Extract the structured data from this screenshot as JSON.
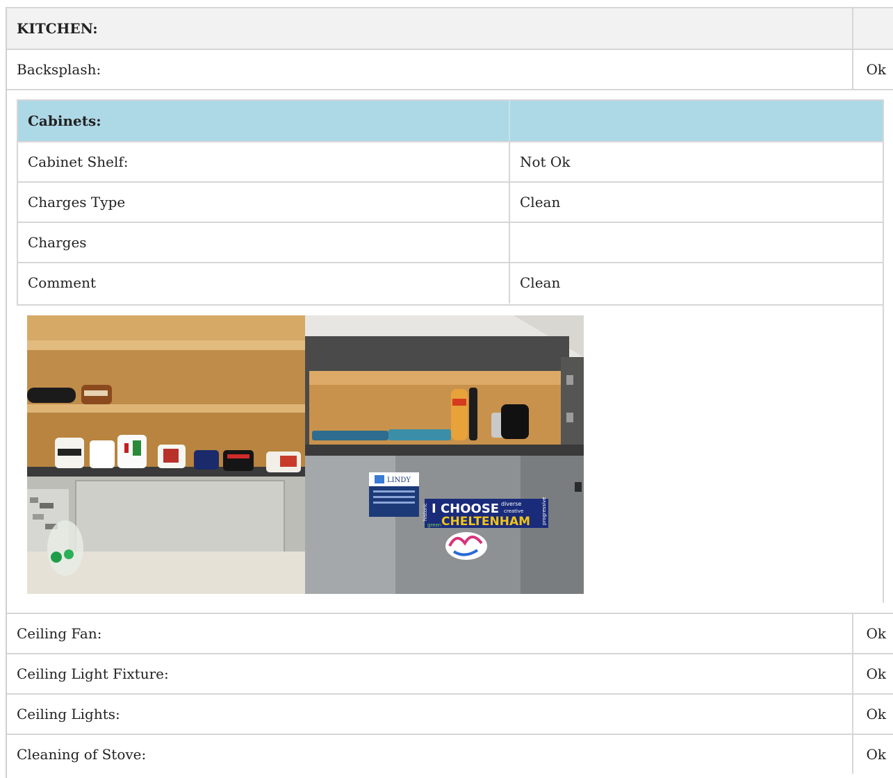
{
  "section": {
    "title": "KITCHEN:",
    "value": ""
  },
  "backsplash": {
    "label": "Backsplash:",
    "value": "Ok"
  },
  "cabinets": {
    "title": "Cabinets:",
    "rows": [
      {
        "label": "Cabinet Shelf:",
        "value": "Not Ok"
      },
      {
        "label": "Charges Type",
        "value": "Clean"
      },
      {
        "label": "Charges",
        "value": ""
      },
      {
        "label": "Comment",
        "value": "Clean"
      }
    ],
    "photos": [
      {
        "description": "open cabinet shelves with mugs"
      },
      {
        "description": "upper cabinet above refrigerator with magnets"
      }
    ],
    "photo_text": {
      "magnet_brand": "LINDY",
      "sticker_line1": "I CHOOSE",
      "sticker_line2": "CHELTENHAM",
      "sticker_words": [
        "historic",
        "green",
        "diverse",
        "creative",
        "progressive"
      ]
    }
  },
  "items": [
    {
      "label": "Ceiling Fan:",
      "value": "Ok"
    },
    {
      "label": "Ceiling Light Fixture:",
      "value": "Ok"
    },
    {
      "label": "Ceiling Lights:",
      "value": "Ok"
    },
    {
      "label": "Cleaning of Stove:",
      "value": "Ok"
    }
  ]
}
